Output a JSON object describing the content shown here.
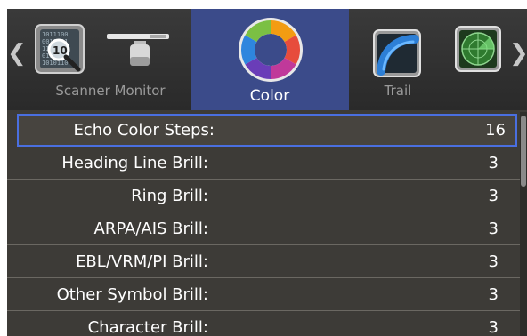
{
  "nav": {
    "left_arrow": "❮",
    "right_arrow": "❯"
  },
  "tabs": [
    {
      "label": "Scanner Monitor",
      "icons": [
        "scan-zoom-icon",
        "monitor-icon"
      ],
      "selected": false
    },
    {
      "label": "Color",
      "icons": [
        "color-wheel-icon"
      ],
      "selected": true
    },
    {
      "label": "Trail",
      "icons": [
        "trail-icon"
      ],
      "selected": false
    },
    {
      "label": "",
      "icons": [
        "radar-icon"
      ],
      "selected": false
    }
  ],
  "settings": [
    {
      "label": "Echo Color Steps:",
      "value": "16",
      "selected": true
    },
    {
      "label": "Heading Line Brill:",
      "value": "3",
      "selected": false
    },
    {
      "label": "Ring Brill:",
      "value": "3",
      "selected": false
    },
    {
      "label": "ARPA/AIS Brill:",
      "value": "3",
      "selected": false
    },
    {
      "label": "EBL/VRM/PI Brill:",
      "value": "3",
      "selected": false
    },
    {
      "label": "Other Symbol Brill:",
      "value": "3",
      "selected": false
    },
    {
      "label": "Character Brill:",
      "value": "3",
      "selected": false
    }
  ],
  "colors": {
    "selected_tab": "#3b4b8a",
    "selection_border": "#4a6fe0",
    "list_background": "#3d3b37"
  }
}
